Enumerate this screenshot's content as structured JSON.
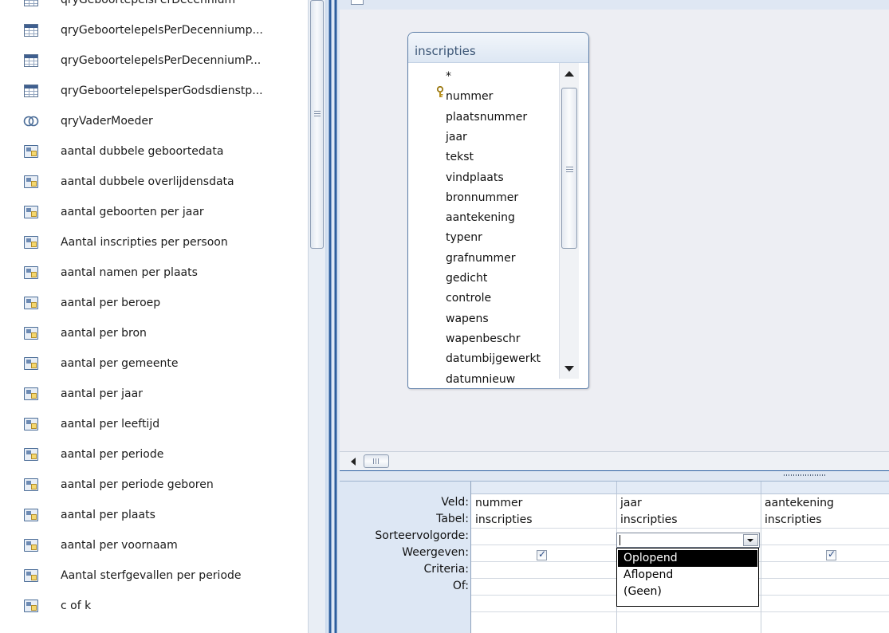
{
  "navigation": {
    "items": [
      {
        "label": "qryGeboortepelsPerDecennium",
        "icon": "grid-icon"
      },
      {
        "label": "qryGeboortelepelsPerDecenniump...",
        "icon": "grid-icon"
      },
      {
        "label": "qryGeboortelepelsPerDecenniumP...",
        "icon": "grid-icon"
      },
      {
        "label": "qryGeboortelepelsperGodsdienstp...",
        "icon": "grid-icon"
      },
      {
        "label": "qryVaderMoeder",
        "icon": "union-icon"
      },
      {
        "label": "aantal dubbele geboortedata",
        "icon": "query-icon"
      },
      {
        "label": "aantal dubbele overlijdensdata",
        "icon": "query-icon"
      },
      {
        "label": "aantal geboorten per jaar",
        "icon": "query-icon"
      },
      {
        "label": "Aantal inscripties per persoon",
        "icon": "query-icon"
      },
      {
        "label": "aantal namen per plaats",
        "icon": "query-icon"
      },
      {
        "label": "aantal per beroep",
        "icon": "query-icon"
      },
      {
        "label": "aantal per bron",
        "icon": "query-icon"
      },
      {
        "label": "aantal per gemeente",
        "icon": "query-icon"
      },
      {
        "label": "aantal per jaar",
        "icon": "query-icon"
      },
      {
        "label": "aantal per leeftijd",
        "icon": "query-icon"
      },
      {
        "label": "aantal per periode",
        "icon": "query-icon"
      },
      {
        "label": "aantal per periode geboren",
        "icon": "query-icon"
      },
      {
        "label": "aantal per plaats",
        "icon": "query-icon"
      },
      {
        "label": "aantal per voornaam",
        "icon": "query-icon"
      },
      {
        "label": "Aantal sterfgevallen per periode",
        "icon": "query-icon"
      },
      {
        "label": "c of k",
        "icon": "query-icon"
      }
    ]
  },
  "field_list": {
    "title": "inscripties",
    "fields": [
      "*",
      "nummer",
      "plaatsnummer",
      "jaar",
      "tekst",
      "vindplaats",
      "bronnummer",
      "aantekening",
      "typenr",
      "grafnummer",
      "gedicht",
      "controle",
      "wapens",
      "wapenbeschr",
      "datumbijgewerkt",
      "datumnieuw"
    ],
    "key_field": "nummer"
  },
  "qbe": {
    "row_labels": {
      "veld": "Veld:",
      "tabel": "Tabel:",
      "sorteer": "Sorteervolgorde:",
      "weergeven": "Weergeven:",
      "criteria": "Criteria:",
      "of": "Of:"
    },
    "columns": [
      {
        "field": "nummer",
        "table": "inscripties",
        "show": true
      },
      {
        "field": "jaar",
        "table": "inscripties",
        "show": false
      },
      {
        "field": "aantekening",
        "table": "inscripties",
        "show": true
      }
    ],
    "sort_dropdown": {
      "value": "",
      "options": [
        "Oplopend",
        "Aflopend",
        "(Geen)"
      ],
      "highlighted": "Oplopend"
    }
  },
  "colors": {
    "pane_background": "#edeef3",
    "qbe_background": "#dde7f4",
    "divider_blue": "#2c5e9e",
    "selection": "#000000"
  }
}
